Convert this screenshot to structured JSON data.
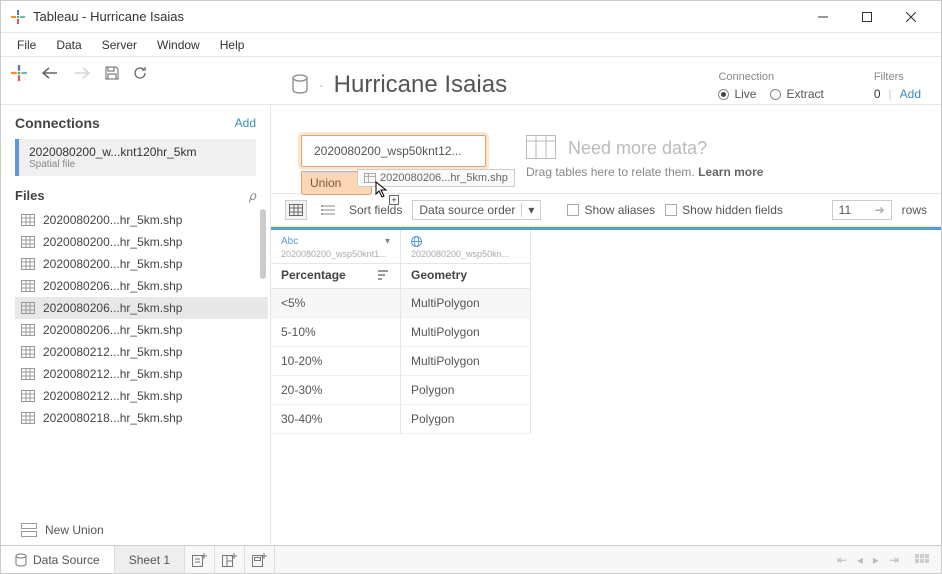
{
  "window": {
    "title": "Tableau - Hurricane Isaias"
  },
  "menubar": {
    "items": [
      "File",
      "Data",
      "Server",
      "Window",
      "Help"
    ]
  },
  "sidebar": {
    "connections_label": "Connections",
    "add_label": "Add",
    "connection": {
      "name": "2020080200_w...knt120hr_5km",
      "type": "Spatial file"
    },
    "files_label": "Files",
    "files": [
      "2020080200...hr_5km.shp",
      "2020080200...hr_5km.shp",
      "2020080200...hr_5km.shp",
      "2020080206...hr_5km.shp",
      "2020080206...hr_5km.shp",
      "2020080206...hr_5km.shp",
      "2020080212...hr_5km.shp",
      "2020080212...hr_5km.shp",
      "2020080212...hr_5km.shp",
      "2020080218...hr_5km.shp"
    ],
    "selected_file_index": 4,
    "new_union_label": "New Union"
  },
  "datasource": {
    "title": "Hurricane Isaias",
    "connection_label": "Connection",
    "live_label": "Live",
    "extract_label": "Extract",
    "filters_label": "Filters",
    "filters_count": "0",
    "filters_add": "Add"
  },
  "canvas": {
    "pill_label": "2020080200_wsp50knt12...",
    "union_label": "Union",
    "drag_ghost_label": "2020080206...hr_5km.shp",
    "need_more_title": "Need more data?",
    "need_more_sub_pre": "Drag tables here to relate them. ",
    "need_more_sub_strong": "Learn more"
  },
  "grid_toolbar": {
    "sort_fields_label": "Sort fields",
    "sort_value": "Data source order",
    "show_aliases_label": "Show aliases",
    "show_hidden_label": "Show hidden fields",
    "rows_value": "11",
    "rows_label": "rows"
  },
  "grid": {
    "columns": [
      {
        "type_label": "Abc",
        "source": "2020080200_wsp50knt1...",
        "name": "Percentage",
        "sorted": true
      },
      {
        "type_label": "globe",
        "source": "2020080200_wsp50kn...",
        "name": "Geometry",
        "sorted": false
      }
    ],
    "rows": [
      [
        "<5%",
        "MultiPolygon"
      ],
      [
        "5-10%",
        "MultiPolygon"
      ],
      [
        "10-20%",
        "MultiPolygon"
      ],
      [
        "20-30%",
        "Polygon"
      ],
      [
        "30-40%",
        "Polygon"
      ]
    ]
  },
  "bottom": {
    "data_source_label": "Data Source",
    "sheet_label": "Sheet 1"
  }
}
